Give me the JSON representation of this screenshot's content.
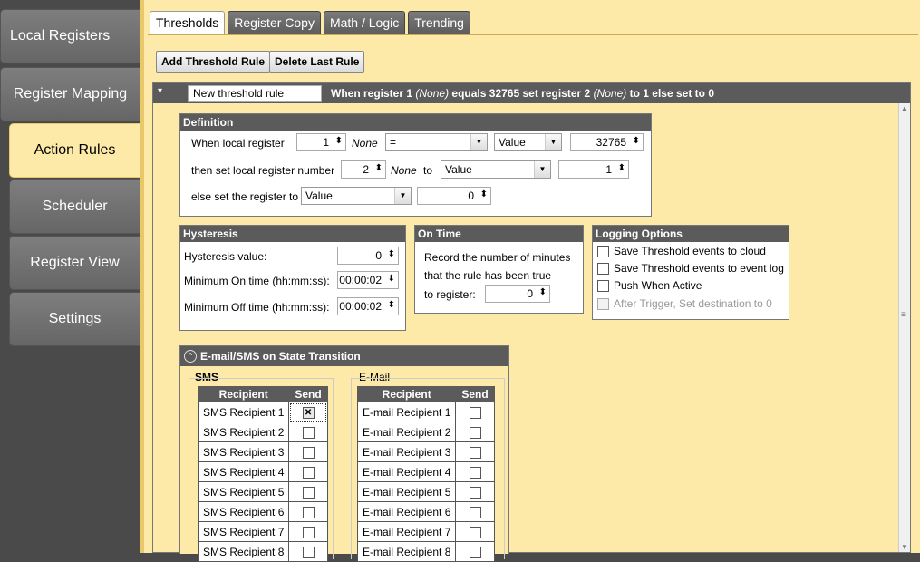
{
  "sidebar": {
    "items": [
      {
        "label": "Local Registers"
      },
      {
        "label": "Register Mapping"
      },
      {
        "label": "Action Rules",
        "active": true
      },
      {
        "label": "Scheduler"
      },
      {
        "label": "Register View"
      },
      {
        "label": "Settings"
      }
    ]
  },
  "tabs": [
    {
      "label": "Thresholds",
      "active": true
    },
    {
      "label": "Register Copy"
    },
    {
      "label": "Math / Logic"
    },
    {
      "label": "Trending"
    }
  ],
  "toolbar": {
    "add_label": "Add Threshold Rule",
    "delete_label": "Delete Last Rule"
  },
  "rule": {
    "name": "New threshold rule",
    "summary": {
      "when_register": "When register",
      "reg1": "1",
      "reg1_name": "(None)",
      "equals": "equals 32765",
      "set_register": "set register",
      "reg2": "2",
      "reg2_name": "(None)",
      "to": "to",
      "to_val": "1",
      "else_set": "else set to",
      "else_val": "0"
    },
    "definition": {
      "title": "Definition",
      "row1_label": "When local register",
      "row1_register": "1",
      "row1_name": "None",
      "row1_operator": "=",
      "row1_type": "Value",
      "row1_value": "32765",
      "row2_label": "then set local register number",
      "row2_register": "2",
      "row2_name": "None",
      "row2_to": "to",
      "row2_type": "Value",
      "row2_value": "1",
      "row3_label": "else set the register to",
      "row3_type": "Value",
      "row3_value": "0"
    },
    "hysteresis": {
      "title": "Hysteresis",
      "value_label": "Hysteresis value:",
      "value": "0",
      "min_on_label": "Minimum On time (hh:mm:ss):",
      "min_on": "00:00:02",
      "min_off_label": "Minimum Off time (hh:mm:ss):",
      "min_off": "00:00:02"
    },
    "on_time": {
      "title": "On Time",
      "line1": "Record the number of minutes",
      "line2": "that the rule has been true",
      "to_register_label": "to register:",
      "register": "0"
    },
    "logging": {
      "title": "Logging Options",
      "options": [
        {
          "label": "Save Threshold events to cloud",
          "checked": false
        },
        {
          "label": "Save Threshold events to event log",
          "checked": false
        },
        {
          "label": "Push When Active",
          "checked": false
        },
        {
          "label": "After Trigger, Set destination to 0",
          "checked": false,
          "disabled": true
        }
      ]
    },
    "notify": {
      "title": "E-mail/SMS on State Transition",
      "sms_label": "SMS",
      "email_label": "E-Mail",
      "col_recipient": "Recipient",
      "col_send": "Send",
      "sms": [
        {
          "name": "SMS Recipient 1",
          "send": true
        },
        {
          "name": "SMS Recipient 2",
          "send": false
        },
        {
          "name": "SMS Recipient 3",
          "send": false
        },
        {
          "name": "SMS Recipient 4",
          "send": false
        },
        {
          "name": "SMS Recipient 5",
          "send": false
        },
        {
          "name": "SMS Recipient 6",
          "send": false
        },
        {
          "name": "SMS Recipient 7",
          "send": false
        },
        {
          "name": "SMS Recipient 8",
          "send": false
        }
      ],
      "email": [
        {
          "name": "E-mail Recipient 1",
          "send": false
        },
        {
          "name": "E-mail Recipient 2",
          "send": false
        },
        {
          "name": "E-mail Recipient 3",
          "send": false
        },
        {
          "name": "E-mail Recipient 4",
          "send": false
        },
        {
          "name": "E-mail Recipient 5",
          "send": false
        },
        {
          "name": "E-mail Recipient 6",
          "send": false
        },
        {
          "name": "E-mail Recipient 7",
          "send": false
        },
        {
          "name": "E-mail Recipient 8",
          "send": false
        }
      ]
    }
  },
  "icons": {
    "spinner": "⬍",
    "dropdown": "▼",
    "collapse": "▾",
    "notify_toggle": "⌃",
    "check": "✕"
  },
  "colors": {
    "panel_bg": "#fde9a8",
    "header_gray": "#5b5b5b"
  }
}
